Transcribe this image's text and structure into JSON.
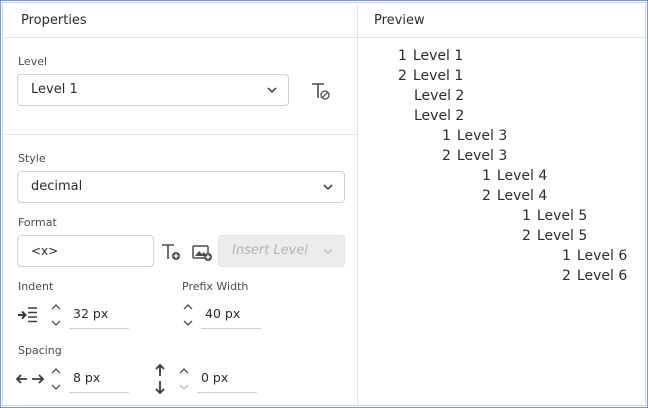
{
  "properties": {
    "title": "Properties",
    "level": {
      "label": "Level",
      "value": "Level 1"
    },
    "style": {
      "label": "Style",
      "value": "decimal"
    },
    "format": {
      "label": "Format",
      "value": "<x>",
      "insert_level": "Insert Level"
    },
    "indent": {
      "label": "Indent",
      "value": "32 px"
    },
    "prefix_width": {
      "label": "Prefix Width",
      "value": "40 px"
    },
    "spacing": {
      "label": "Spacing",
      "horizontal": "8 px",
      "vertical": "0 px"
    }
  },
  "preview": {
    "title": "Preview",
    "lines": [
      {
        "num": "1",
        "text": "Level 1"
      },
      {
        "num": "2",
        "text": "Level 1"
      },
      {
        "num": "",
        "text": "Level 2"
      },
      {
        "num": "",
        "text": "Level 2"
      },
      {
        "num": "1",
        "text": "Level 3"
      },
      {
        "num": "2",
        "text": "Level 3"
      },
      {
        "num": "1",
        "text": "Level 4"
      },
      {
        "num": "2",
        "text": "Level 4"
      },
      {
        "num": "1",
        "text": "Level 5"
      },
      {
        "num": "2",
        "text": "Level 5"
      },
      {
        "num": "1",
        "text": "Level 6"
      },
      {
        "num": "2",
        "text": "Level 6"
      }
    ]
  },
  "colors": {
    "border": "#7a99c4",
    "divider": "#e1e1e1",
    "disabled_bg": "#ececec"
  },
  "icons": [
    "clear-format-icon",
    "chevron-down-icon",
    "insert-text-variable-icon",
    "insert-image-icon",
    "indent-icon",
    "stepper-icon",
    "horizontal-spacing-icon",
    "vertical-spacing-icon"
  ]
}
